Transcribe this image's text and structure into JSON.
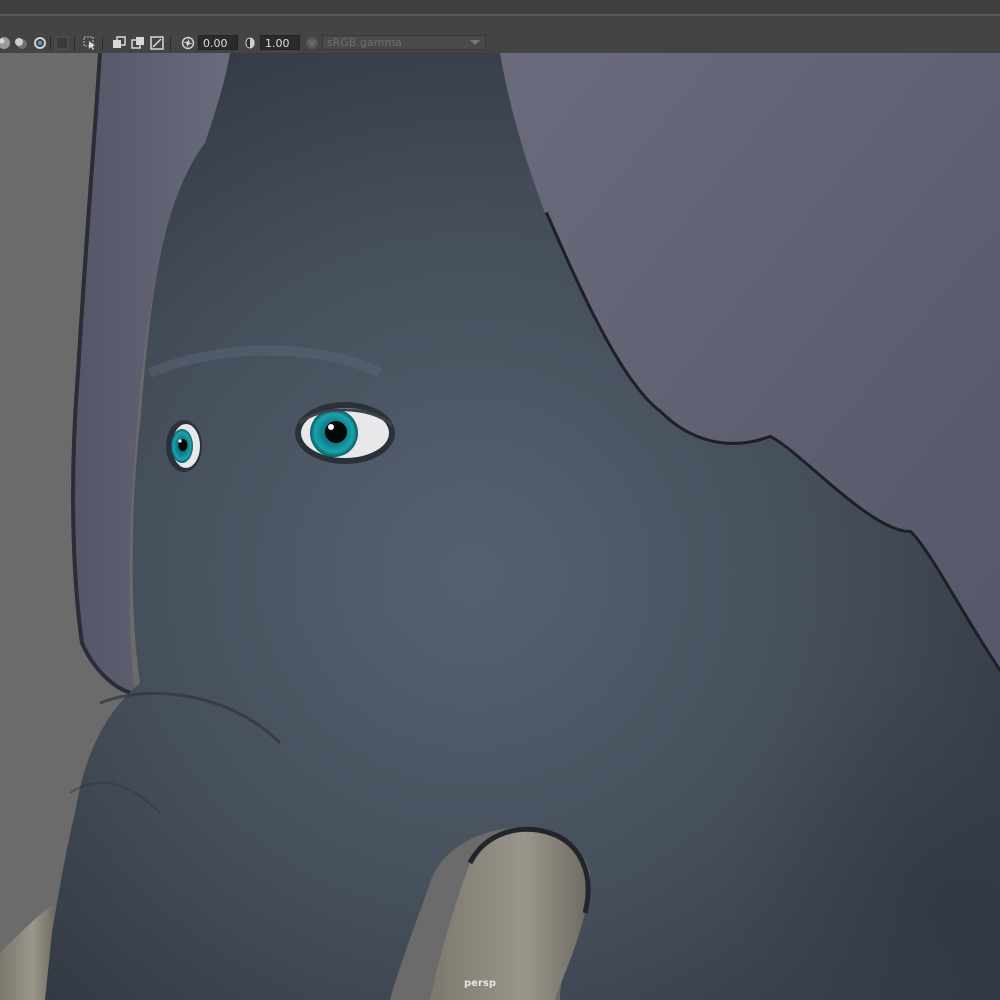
{
  "toolbar": {
    "exposure_value": "0.00",
    "gamma_value": "1.00",
    "color_space": "sRGB gamma",
    "icons": [
      "shaded-sphere-icon",
      "half-sphere-icon",
      "isolate-select-icon",
      "grid-toggle-icon",
      "select-camera-icon",
      "film-gate-icon",
      "resolution-gate-icon",
      "safe-action-icon",
      "exposure-icon",
      "gamma-icon",
      "color-management-icon"
    ]
  },
  "viewport": {
    "camera": "persp",
    "background_color": "#6b6b6b",
    "model_colors": {
      "skin": "#46505c",
      "ear": "#5e6070",
      "tusk": "#8c887e",
      "iris": "#1aa3ad"
    }
  }
}
